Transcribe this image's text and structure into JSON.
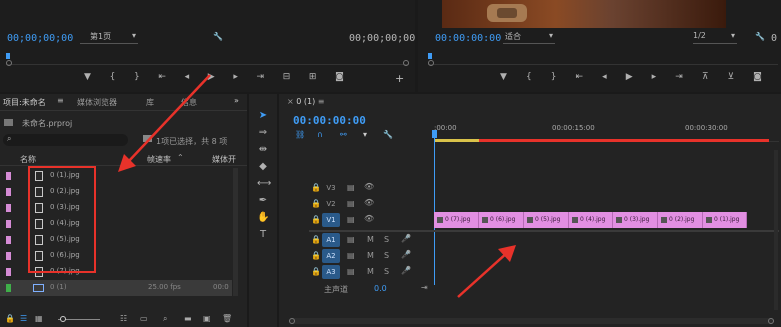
{
  "source_monitor": {
    "timecode_left": "00;00;00;00",
    "page_select": "第1页",
    "timecode_right": "00;00;00;00"
  },
  "program_monitor": {
    "timecode": "00:00:00:00",
    "fit_select": "适合",
    "resolution": "1/2"
  },
  "project_panel": {
    "tabs": [
      "项目:未命名",
      "媒体浏览器",
      "库",
      "信息"
    ],
    "project_file": "未命名.prproj",
    "selection_info": "1项已选择，共 8 项",
    "col_name": "名称",
    "col_fps": "帧速率",
    "col_media": "媒体开",
    "items": [
      {
        "name": "0 (1).jpg",
        "color": "#d58bd5"
      },
      {
        "name": "0 (2).jpg",
        "color": "#d58bd5"
      },
      {
        "name": "0 (3).jpg",
        "color": "#d58bd5"
      },
      {
        "name": "0 (4).jpg",
        "color": "#d58bd5"
      },
      {
        "name": "0 (5).jpg",
        "color": "#d58bd5"
      },
      {
        "name": "0 (6).jpg",
        "color": "#d58bd5"
      },
      {
        "name": "0 (7).jpg",
        "color": "#d58bd5"
      }
    ],
    "sequence": {
      "name": "0 (1)",
      "fps": "25.00 fps",
      "media": "00:0",
      "color": "#3fae49"
    }
  },
  "timeline": {
    "tab": "0 (1)",
    "timecode": "00:00:00:00",
    "ruler": [
      ":00:00",
      "00:00:15:00",
      "00:00:30:00"
    ],
    "video_tracks": [
      "V3",
      "V2",
      "V1"
    ],
    "audio_tracks": [
      "A1",
      "A2",
      "A3"
    ],
    "master_label": "主声道",
    "master_value": "0.0",
    "clips": [
      "0 (7).jpg",
      "0 (6).jpg",
      "0 (5).jpg",
      "0 (4).jpg",
      "0 (3).jpg",
      "0 (2).jpg",
      "0 (1).jpg"
    ],
    "track_m": "M",
    "track_s": "S"
  },
  "colors": {
    "accent_blue": "#3f9cf5",
    "clip_pink": "#e28fe2",
    "annotation_red": "#e8322a"
  }
}
